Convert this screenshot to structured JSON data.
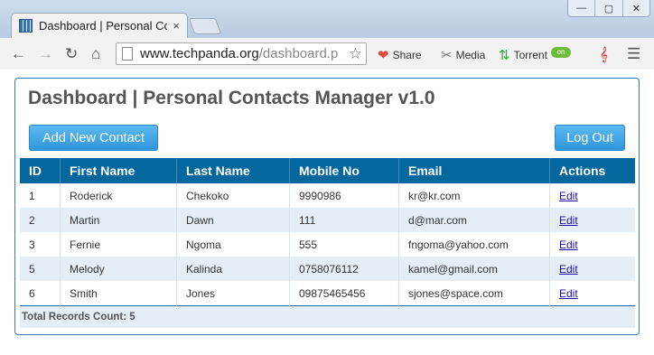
{
  "browser": {
    "tab_title": "Dashboard | Personal Con",
    "tab_close": "×",
    "url_host": "www.techpanda.org",
    "url_path": "/dashboard.p",
    "extensions": {
      "share": "Share",
      "media": "Media",
      "torrent": "Torrent",
      "toggle": "on"
    },
    "window_buttons": [
      "—",
      "▢",
      "✕"
    ]
  },
  "page": {
    "title": "Dashboard | Personal Contacts Manager v1.0",
    "add_button": "Add New Contact",
    "logout_button": "Log Out",
    "columns": [
      "ID",
      "First Name",
      "Last Name",
      "Mobile No",
      "Email",
      "Actions"
    ],
    "rows": [
      {
        "id": "1",
        "first": "Roderick",
        "last": "Chekoko",
        "mobile": "9990986",
        "email": "kr@kr.com",
        "action": "Edit"
      },
      {
        "id": "2",
        "first": "Martin",
        "last": "Dawn",
        "mobile": "111",
        "email": "d@mar.com",
        "action": "Edit"
      },
      {
        "id": "3",
        "first": "Fernie",
        "last": "Ngoma",
        "mobile": "555",
        "email": "fngoma@yahoo.com",
        "action": "Edit"
      },
      {
        "id": "5",
        "first": "Melody",
        "last": "Kalinda",
        "mobile": "0758076112",
        "email": "kamel@gmail.com",
        "action": "Edit"
      },
      {
        "id": "6",
        "first": "Smith",
        "last": "Jones",
        "mobile": "09875465456",
        "email": "sjones@space.com",
        "action": "Edit"
      }
    ],
    "total_label": "Total Records Count: 5"
  }
}
